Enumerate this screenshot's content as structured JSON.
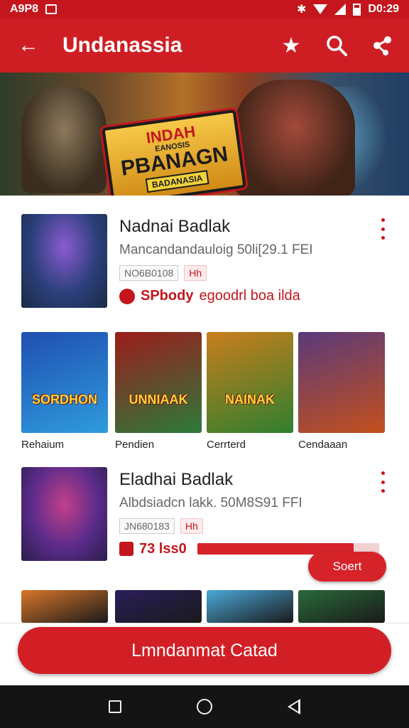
{
  "status_bar": {
    "left_text": "A9P8",
    "time": "D0:29"
  },
  "app_bar": {
    "title": "Undanassia",
    "icons": {
      "back": "arrow-left-icon",
      "favorite": "star-icon",
      "search": "search-icon",
      "share": "share-icon"
    }
  },
  "banner": {
    "logo_line1": "INDAH",
    "logo_line2": "EANOSIS",
    "logo_line3": "PBANAGN",
    "logo_line4": "BADANASIA"
  },
  "card1": {
    "name": "Nadnai Badlak",
    "subtitle": "Mancandandauloig 50li[29.1 FEI",
    "tag1": "NO6B0108",
    "tag2": "Hh",
    "promo_bold": "SPbody",
    "promo_text": "egoodrl boa ilda"
  },
  "grid_items": [
    {
      "label": "Rehaium",
      "art_text": "SORDHON",
      "colors": [
        "#1f4fb2",
        "#2f9bdc"
      ]
    },
    {
      "label": "Pendien",
      "art_text": "UNNIAAK",
      "colors": [
        "#9c1c1c",
        "#2c7a3a"
      ]
    },
    {
      "label": "Cerrterd",
      "art_text": "NAINAK",
      "colors": [
        "#c97e1c",
        "#2f7f2f"
      ]
    },
    {
      "label": "Cendaaan",
      "art_text": "",
      "colors": [
        "#5a3a7a",
        "#c4501c"
      ]
    }
  ],
  "card2": {
    "name": "Eladhai Badlak",
    "subtitle": "Albdsiadcn lakk. 50M8S91 FFI",
    "tag1": "JN680183",
    "tag2": "Hh",
    "progress_text": "73 lss0",
    "progress_value": 0.86
  },
  "sort_button": "Soert",
  "bottom_partial_colors": [
    "#d9762a",
    "#2a1e5a",
    "#4aa8d9",
    "#2a6a3a"
  ],
  "cta": "Lmndanmat Catad",
  "colors": {
    "accent": "#cf1e23",
    "accent_dark": "#c4161c"
  }
}
